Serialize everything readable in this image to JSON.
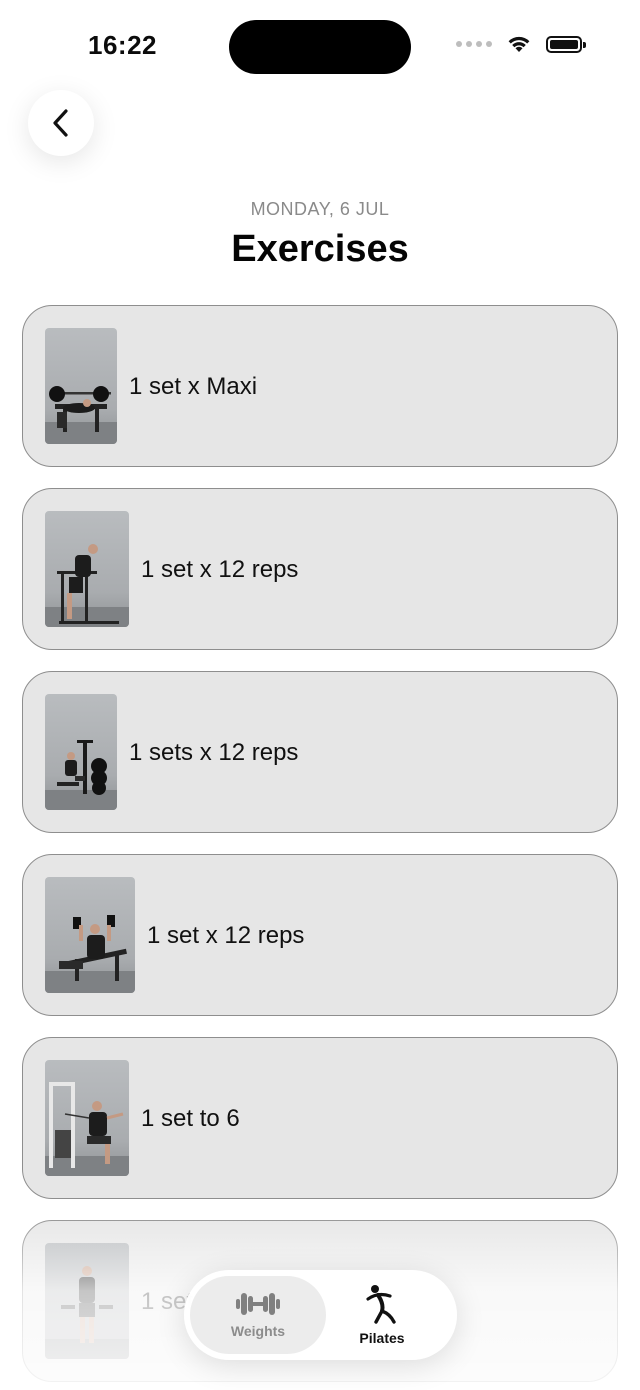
{
  "status_bar": {
    "time": "16:22"
  },
  "header": {
    "date": "MONDAY, 6 JUL",
    "title": "Exercises"
  },
  "exercises": [
    {
      "detail": "1 set x Maxi",
      "image": "bench-press-photo"
    },
    {
      "detail": "1 set x 12 reps",
      "image": "dips-photo"
    },
    {
      "detail": "1 sets x 12 reps",
      "image": "machine-row-photo"
    },
    {
      "detail": "1 set x 12 reps",
      "image": "dumbbell-press-photo"
    },
    {
      "detail": "1 set to 6",
      "image": "cable-machine-photo"
    },
    {
      "detail": "1 set",
      "image": "dumbbell-curl-photo"
    }
  ],
  "tab_bar": {
    "tabs": [
      {
        "label": "Weights",
        "icon": "dumbbell-icon",
        "selected": true
      },
      {
        "label": "Pilates",
        "icon": "stretching-figure-icon",
        "selected": false
      }
    ]
  },
  "colors": {
    "card_background": "#e6e6e6",
    "card_border": "#8e8e8e",
    "accent_text": "#0b0b0b",
    "muted_text": "#8a8a8a"
  }
}
